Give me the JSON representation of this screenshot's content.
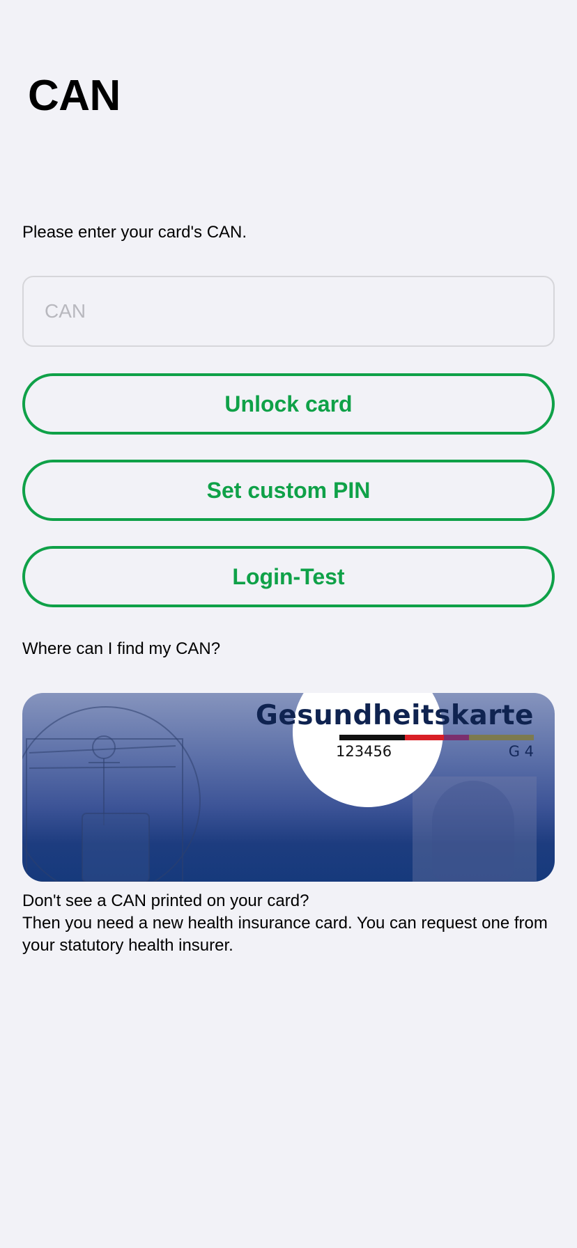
{
  "page": {
    "title": "CAN",
    "prompt": "Please enter your card's CAN."
  },
  "can_input": {
    "value": "",
    "placeholder": "CAN"
  },
  "buttons": {
    "unlock": "Unlock card",
    "set_pin": "Set custom PIN",
    "login_test": "Login-Test"
  },
  "help": {
    "question": "Where can I find my CAN?",
    "card": {
      "title": "Gesundheitskarte",
      "can_number": "123456",
      "generation": "G 4"
    },
    "no_can_heading": "Don't see a CAN printed on your card?",
    "no_can_body": "Then you need a new health insurance card. You can request one from your statutory health insurer."
  },
  "colors": {
    "accent": "#0fa148",
    "background": "#f2f2f7",
    "card_blue": "#163a7c"
  }
}
